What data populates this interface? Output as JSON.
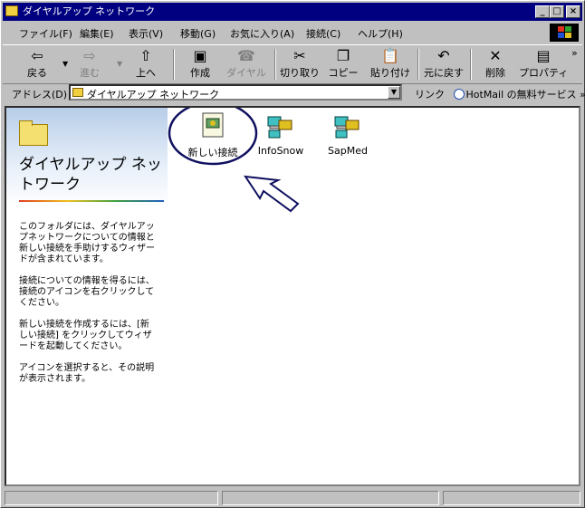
{
  "window": {
    "title": "ダイヤルアップ ネットワーク"
  },
  "title_buttons": {
    "minimize": "_",
    "maximize": "□",
    "close": "×"
  },
  "menu": [
    "ファイル(F)",
    "編集(E)",
    "表示(V)",
    "移動(G)",
    "お気に入り(A)",
    "接続(C)",
    "ヘルプ(H)"
  ],
  "toolbar": {
    "back": "戻る",
    "forward": "進む",
    "up": "上へ",
    "create": "作成",
    "dialup": "ダイヤル",
    "cut": "切り取り",
    "copy": "コピー",
    "paste": "貼り付け",
    "undo": "元に戻す",
    "delete": "削除",
    "properties": "プロパティ",
    "more": "»"
  },
  "address": {
    "label": "アドレス(D)",
    "value": "ダイヤルアップ ネットワーク",
    "links": "リンク",
    "link1": "HotMail の無料サービス",
    "more": "»"
  },
  "leftpane": {
    "title": "ダイヤルアップ ネットワーク",
    "p1": "このフォルダには、ダイヤルアップネットワークについての情報と新しい接続を手助けするウィザードが含まれています。",
    "p2": "接続についての情報を得るには、接続のアイコンを右クリックしてください。",
    "p3": "新しい接続を作成するには、[新しい接続] をクリックしてウィザードを起動してください。",
    "p4": "アイコンを選択すると、その説明が表示されます。"
  },
  "icons": [
    "新しい接続",
    "InfoSnow",
    "SapMed"
  ],
  "colors": {
    "titlebar": "#000080",
    "face": "#c0c0c0",
    "annotation": "#101060"
  }
}
